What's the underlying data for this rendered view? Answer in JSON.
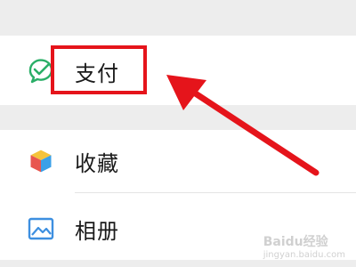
{
  "menu": {
    "items": [
      {
        "label": "支付",
        "icon": "wechat-pay-icon",
        "icon_color": "#2aae67"
      },
      {
        "label": "收藏",
        "icon": "favorites-cube-icon"
      },
      {
        "label": "相册",
        "icon": "album-picture-icon",
        "icon_color": "#3d8fe0"
      }
    ]
  },
  "annotation": {
    "highlight_color": "#e5141b",
    "arrow_color": "#e5141b"
  },
  "watermark": {
    "brand": "Baidu经验",
    "url": "jingyan.baidu.com"
  }
}
